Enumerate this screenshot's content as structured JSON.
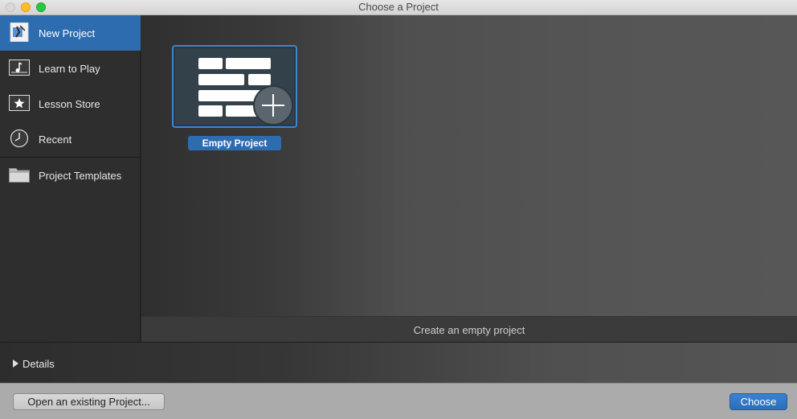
{
  "window": {
    "title": "Choose a Project"
  },
  "sidebar": {
    "items": [
      {
        "label": "New Project",
        "icon": "new-project-icon",
        "selected": true
      },
      {
        "label": "Learn to Play",
        "icon": "music-note-icon",
        "selected": false
      },
      {
        "label": "Lesson Store",
        "icon": "star-icon",
        "selected": false
      },
      {
        "label": "Recent",
        "icon": "clock-icon",
        "selected": false
      },
      {
        "label": "Project Templates",
        "icon": "folder-icon",
        "selected": false
      }
    ]
  },
  "main": {
    "tiles": [
      {
        "label": "Empty Project",
        "icon": "empty-project-icon",
        "selected": true
      }
    ],
    "description": "Create an empty project"
  },
  "details": {
    "label": "Details"
  },
  "footer": {
    "open_label": "Open an existing Project...",
    "choose_label": "Choose"
  },
  "colors": {
    "accent": "#2e6cb0",
    "sidebar_bg": "#2e2e2e",
    "footer_bg": "#ababab"
  }
}
